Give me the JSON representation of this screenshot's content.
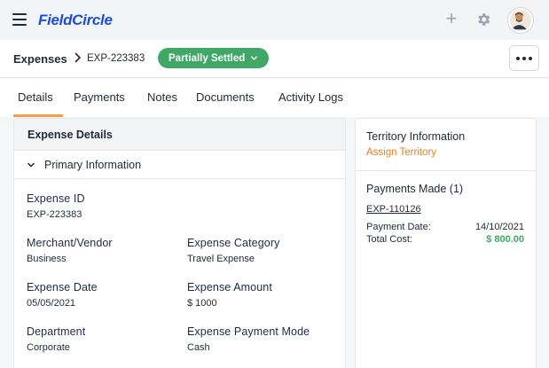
{
  "app": {
    "brand": "FieldCircle"
  },
  "topbar": {
    "add_icon": "plus-icon",
    "settings_icon": "gear-icon",
    "avatar_icon": "user-avatar"
  },
  "breadcrumb": {
    "root": "Expenses",
    "current": "EXP-223383"
  },
  "status": {
    "label": "Partially Settled",
    "color": "#3fa866"
  },
  "tabs": [
    {
      "label": "Details",
      "active": true
    },
    {
      "label": "Payments",
      "active": false
    },
    {
      "label": "Notes",
      "active": false
    },
    {
      "label": "Documents",
      "active": false
    },
    {
      "label": "Activity Logs",
      "active": false
    }
  ],
  "expense_details": {
    "title": "Expense Details",
    "section": "Primary Information",
    "fields": {
      "expense_id": {
        "label": "Expense ID",
        "value": "EXP-223383"
      },
      "merchant": {
        "label": "Merchant/Vendor",
        "value": "Business"
      },
      "category": {
        "label": "Expense Category",
        "value": "Travel Expense"
      },
      "date": {
        "label": "Expense Date",
        "value": "05/05/2021"
      },
      "amount": {
        "label": "Expense Amount",
        "value": "$ 1000"
      },
      "department": {
        "label": "Department",
        "value": "Corporate"
      },
      "payment_mode": {
        "label": "Expense Payment Mode",
        "value": "Cash"
      }
    }
  },
  "territory": {
    "title": "Territory Information",
    "link": "Assign Territory"
  },
  "payments_made": {
    "title": "Payments Made (1)",
    "items": [
      {
        "id": "EXP-110126",
        "date_label": "Payment Date:",
        "date": "14/10/2021",
        "cost_label": "Total Cost:",
        "cost": "$ 800.00"
      }
    ]
  },
  "colors": {
    "accent": "#f59e42",
    "link": "#f07d16",
    "brand": "#1d4ed8",
    "success": "#3fa866"
  }
}
